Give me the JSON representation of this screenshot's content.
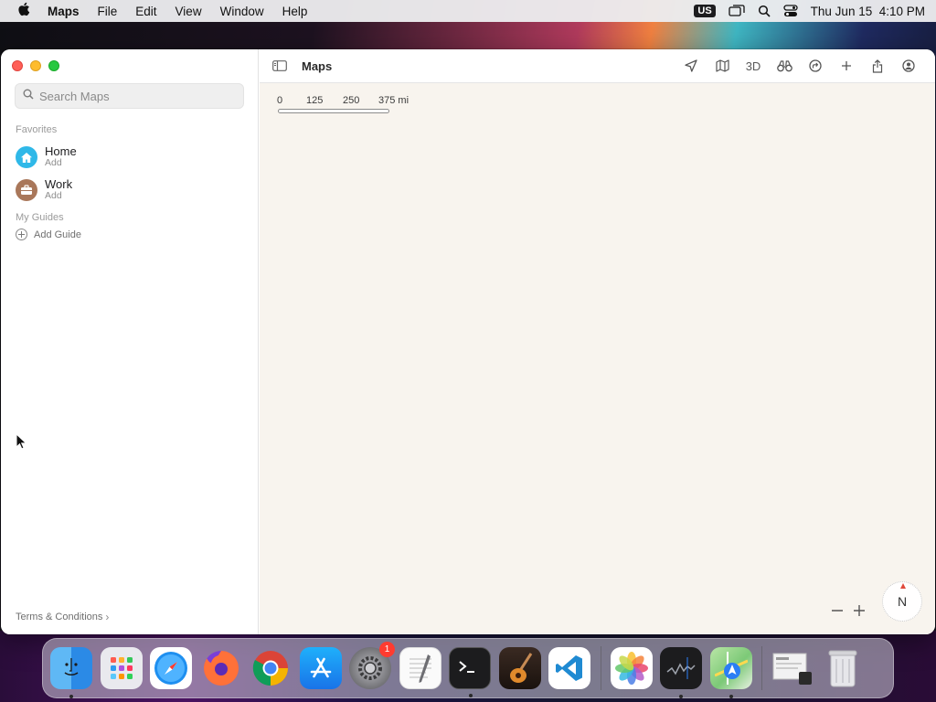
{
  "menubar": {
    "app_name": "Maps",
    "menus": [
      "File",
      "Edit",
      "View",
      "Window",
      "Help"
    ],
    "input_source": "US",
    "datetime": "Thu Jun 15  4:10 PM"
  },
  "sidebar": {
    "search": {
      "placeholder": "Search Maps",
      "value": ""
    },
    "favorites_title": "Favorites",
    "favorites": [
      {
        "name": "Home",
        "sub": "Add",
        "icon": "house-icon",
        "color": "#2fb8e8"
      },
      {
        "name": "Work",
        "sub": "Add",
        "icon": "briefcase-icon",
        "color": "#a9775a"
      }
    ],
    "guides_title": "My Guides",
    "add_guide": "Add Guide",
    "terms": "Terms & Conditions"
  },
  "toolbar": {
    "title": "Maps",
    "three_d_label": "3D"
  },
  "map": {
    "scale_labels": [
      "0",
      "125",
      "250",
      "375 mi"
    ],
    "compass_label": "N",
    "background_color": "#f8f4ee"
  },
  "dock": {
    "items": [
      {
        "name": "finder",
        "running": true
      },
      {
        "name": "launchpad",
        "running": false
      },
      {
        "name": "safari",
        "running": false
      },
      {
        "name": "firefox",
        "running": false
      },
      {
        "name": "chrome",
        "running": false
      },
      {
        "name": "app-store",
        "running": false
      },
      {
        "name": "system-settings",
        "running": false,
        "badge": "1"
      },
      {
        "name": "textedit",
        "running": false
      },
      {
        "name": "terminal",
        "running": true
      },
      {
        "name": "garageband",
        "running": false
      },
      {
        "name": "vscode",
        "running": false
      },
      {
        "name": "photos",
        "running": false
      },
      {
        "name": "stocks",
        "running": true
      },
      {
        "name": "maps",
        "running": true
      },
      {
        "name": "downloads-stack",
        "running": false
      },
      {
        "name": "trash",
        "running": false
      }
    ]
  }
}
